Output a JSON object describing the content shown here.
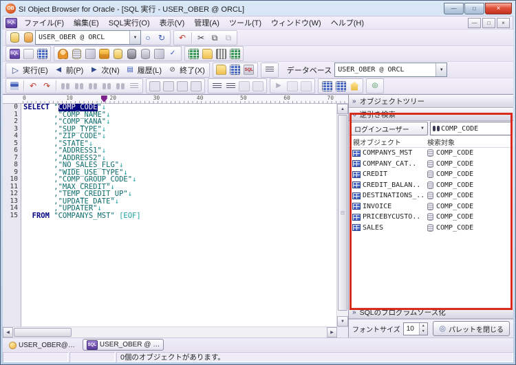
{
  "window": {
    "title": "SI Object Browser for Oracle - [SQL 実行 - USER_OBER @ ORCL]",
    "app_badge": "OB",
    "mdi_badge": "SQL"
  },
  "menu": {
    "items": [
      "ファイル(F)",
      "編集(E)",
      "SQL実行(O)",
      "表示(V)",
      "管理(A)",
      "ツール(T)",
      "ウィンドウ(W)",
      "ヘルプ(H)"
    ]
  },
  "icons": {
    "minimize": "—",
    "restore": "□",
    "close": "×",
    "mdi_minimize": "—",
    "mdi_restore": "□",
    "mdi_close": "×",
    "dropdown": "▼",
    "circle": "○",
    "refresh": "↻",
    "undo": "↶",
    "redo": "↷",
    "scissors": "✂",
    "copy": "⧉",
    "paste": "⧉",
    "run": "▷",
    "prev": "◀",
    "next": "▶",
    "history": "▤",
    "terminate": "⊘",
    "chevrons": "»",
    "spin_up": "▲",
    "spin_down": "▼",
    "scroll_up": "▲",
    "scroll_down": "▼",
    "scroll_left": "◀",
    "scroll_right": "▶",
    "palette_close": "◎",
    "check": "✓"
  },
  "toolbar_session": {
    "combo_value": "USER_OBER @ ORCL"
  },
  "toolbar_exec": {
    "run": "実行(E)",
    "prev": "前(P)",
    "next": "次(N)",
    "history": "履歴(L)",
    "terminate": "終了(X)",
    "db_label": "データベース",
    "db_value": "USER_OBER @ ORCL"
  },
  "ruler": {
    "marks": [
      "0",
      "10",
      "20",
      "30",
      "40",
      "50",
      "60",
      "70"
    ],
    "marker_col": 18
  },
  "editor": {
    "lines": [
      {
        "no": "0",
        "segs": [
          {
            "t": "SELECT ",
            "c": "kw"
          },
          {
            "t": "\"",
            "c": "id"
          },
          {
            "t": "COMP_CODE",
            "c": "sel"
          },
          {
            "t": "\"",
            "c": "id"
          },
          {
            "t": "↓",
            "c": "ar"
          }
        ]
      },
      {
        "no": "1",
        "segs": [
          {
            "t": "       ",
            "c": "pl"
          },
          {
            "t": ",\"COMP_NAME\"",
            "c": "id"
          },
          {
            "t": "↓",
            "c": "ar"
          }
        ]
      },
      {
        "no": "2",
        "segs": [
          {
            "t": "       ",
            "c": "pl"
          },
          {
            "t": ",\"COMP_KANA\"",
            "c": "id"
          },
          {
            "t": "↓",
            "c": "ar"
          }
        ]
      },
      {
        "no": "3",
        "segs": [
          {
            "t": "       ",
            "c": "pl"
          },
          {
            "t": ",\"SUP_TYPE\"",
            "c": "id"
          },
          {
            "t": "↓",
            "c": "ar"
          }
        ]
      },
      {
        "no": "4",
        "segs": [
          {
            "t": "       ",
            "c": "pl"
          },
          {
            "t": ",\"ZIP_CODE\"",
            "c": "id"
          },
          {
            "t": "↓",
            "c": "ar"
          }
        ]
      },
      {
        "no": "5",
        "segs": [
          {
            "t": "       ",
            "c": "pl"
          },
          {
            "t": ",\"STATE\"",
            "c": "id"
          },
          {
            "t": "↓",
            "c": "ar"
          }
        ]
      },
      {
        "no": "6",
        "segs": [
          {
            "t": "       ",
            "c": "pl"
          },
          {
            "t": ",\"ADDRESS1\"",
            "c": "id"
          },
          {
            "t": "↓",
            "c": "ar"
          }
        ]
      },
      {
        "no": "7",
        "segs": [
          {
            "t": "       ",
            "c": "pl"
          },
          {
            "t": ",\"ADDRESS2\"",
            "c": "id"
          },
          {
            "t": "↓",
            "c": "ar"
          }
        ]
      },
      {
        "no": "8",
        "segs": [
          {
            "t": "       ",
            "c": "pl"
          },
          {
            "t": ",\"NO_SALES_FLG\"",
            "c": "id"
          },
          {
            "t": "↓",
            "c": "ar"
          }
        ]
      },
      {
        "no": "9",
        "segs": [
          {
            "t": "       ",
            "c": "pl"
          },
          {
            "t": ",\"WIDE_USE_TYPE\"",
            "c": "id"
          },
          {
            "t": "↓",
            "c": "ar"
          }
        ]
      },
      {
        "no": "10",
        "segs": [
          {
            "t": "       ",
            "c": "pl"
          },
          {
            "t": ",\"COMP_GROUP_CODE\"",
            "c": "id"
          },
          {
            "t": "↓",
            "c": "ar"
          }
        ]
      },
      {
        "no": "11",
        "segs": [
          {
            "t": "       ",
            "c": "pl"
          },
          {
            "t": ",\"MAX_CREDIT\"",
            "c": "id"
          },
          {
            "t": "↓",
            "c": "ar"
          }
        ]
      },
      {
        "no": "12",
        "segs": [
          {
            "t": "       ",
            "c": "pl"
          },
          {
            "t": ",\"TEMP_CREDIT_UP\"",
            "c": "id"
          },
          {
            "t": "↓",
            "c": "ar"
          }
        ]
      },
      {
        "no": "13",
        "segs": [
          {
            "t": "       ",
            "c": "pl"
          },
          {
            "t": ",\"UPDATE_DATE\"",
            "c": "id"
          },
          {
            "t": "↓",
            "c": "ar"
          }
        ]
      },
      {
        "no": "14",
        "segs": [
          {
            "t": "       ",
            "c": "pl"
          },
          {
            "t": ",\"UPDATER\"",
            "c": "id"
          },
          {
            "t": "↓",
            "c": "ar"
          }
        ]
      },
      {
        "no": "15",
        "segs": [
          {
            "t": "  ",
            "c": "pl"
          },
          {
            "t": "FROM ",
            "c": "kw"
          },
          {
            "t": "\"COMPANYS_MST\" ",
            "c": "id"
          },
          {
            "t": "[EOF]",
            "c": "eof"
          }
        ]
      }
    ]
  },
  "panel": {
    "tree_header": "オブジェクトツリー",
    "search_header": "逆引き検索",
    "scope_button": "ログインユーザー",
    "search_value": "COMP_CODE",
    "col_parent": "親オブジェクト",
    "col_target": "検索対象",
    "rows": [
      {
        "name": "COMPANYS_MST",
        "target": "COMP_CODE"
      },
      {
        "name": "COMPANY_CAT..",
        "target": "COMP_CODE"
      },
      {
        "name": "CREDIT",
        "target": "COMP_CODE"
      },
      {
        "name": "CREDIT_BALAN..",
        "target": "COMP_CODE"
      },
      {
        "name": "DESTINATIONS_..",
        "target": "COMP_CODE"
      },
      {
        "name": "INVOICE",
        "target": "COMP_CODE"
      },
      {
        "name": "PRICEBYCUSTO..",
        "target": "COMP_CODE"
      },
      {
        "name": "SALES",
        "target": "COMP_CODE"
      }
    ],
    "source_header": "SQLのプログラムソース化",
    "font_label": "フォントサイズ",
    "font_size": "10",
    "close_button": "パレットを閉じる"
  },
  "tabs": {
    "session_tab": "USER_OBER@…",
    "sql_tab": "USER_OBER @ …",
    "sql_tab_badge": "SQL"
  },
  "status": {
    "message": "0個のオブジェクトがあります。"
  },
  "colors": {
    "annotation": "#da2a1e",
    "selection": "#00007f",
    "keyword": "#00007f"
  }
}
